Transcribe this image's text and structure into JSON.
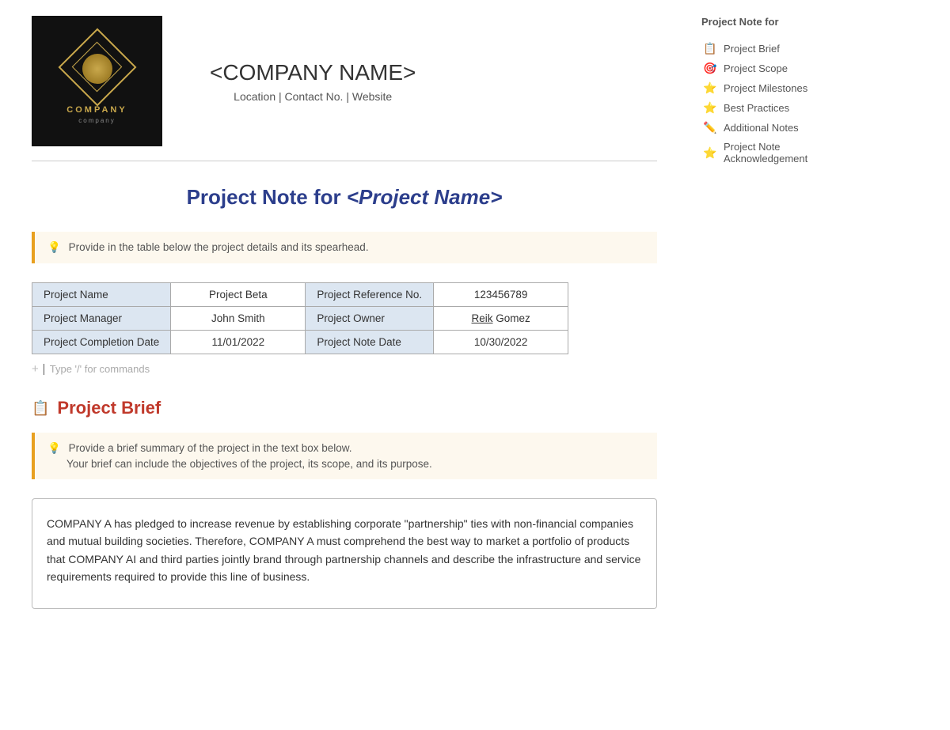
{
  "header": {
    "logo_text_company": "COMPANY",
    "logo_text_sub": "company",
    "company_name": "<COMPANY NAME>",
    "company_details": "Location | Contact No. | Website"
  },
  "page_title": {
    "prefix": "Project Note for ",
    "project_name": "<Project Name>"
  },
  "info_box_1": {
    "text": "Provide in the table below the project details and its spearhead."
  },
  "table": {
    "rows": [
      [
        "Project Name",
        "Project Beta",
        "Project Reference No.",
        "123456789"
      ],
      [
        "Project Manager",
        "John Smith",
        "Project Owner",
        "Reik Gomez"
      ],
      [
        "Project Completion Date",
        "11/01/2022",
        "Project Note Date",
        "10/30/2022"
      ]
    ]
  },
  "command_placeholder": "Type '/' for commands",
  "section_brief": {
    "icon": "📋",
    "title": "Project Brief",
    "info_box": {
      "line1": "Provide a brief summary of the project in the text box below.",
      "line2": "Your brief can include the objectives of the project, its scope, and its purpose."
    },
    "content": "COMPANY A has pledged to increase revenue by establishing corporate \"partnership\" ties with non-financial companies and mutual building societies. Therefore, COMPANY A must comprehend the best way to market a portfolio of products that COMPANY AI and third parties jointly brand through partnership channels and describe the infrastructure and service requirements required to provide this line of business."
  },
  "sidebar": {
    "title": "Project Note for",
    "items": [
      {
        "icon": "📋",
        "label": "Project Brief"
      },
      {
        "icon": "🎯",
        "label": "Project Scope"
      },
      {
        "icon": "⭐",
        "label": "Project Milestones"
      },
      {
        "icon": "⭐",
        "label": "Best Practices"
      },
      {
        "icon": "✏️",
        "label": "Additional Notes"
      },
      {
        "icon": "⭐",
        "label": "Project Note Acknowledgement"
      }
    ]
  }
}
